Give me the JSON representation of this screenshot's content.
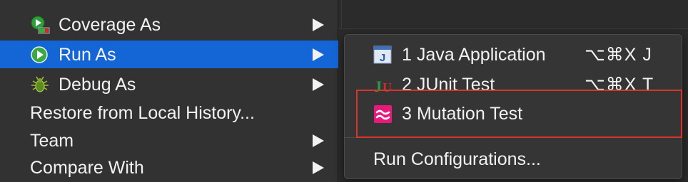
{
  "menu": {
    "items": [
      {
        "label": "Coverage As",
        "icon": "coverage-icon",
        "has_submenu": true
      },
      {
        "label": "Run As",
        "icon": "run-icon",
        "has_submenu": true,
        "selected": true
      },
      {
        "label": "Debug As",
        "icon": "debug-icon",
        "has_submenu": true
      },
      {
        "label": "Restore from Local History...",
        "has_submenu": false
      },
      {
        "label": "Team",
        "has_submenu": true
      },
      {
        "label": "Compare With",
        "has_submenu": true
      }
    ]
  },
  "submenu": {
    "items": [
      {
        "label": "1 Java Application",
        "shortcut": "⌥⌘X J",
        "icon": "java-application-icon"
      },
      {
        "label": "2 JUnit Test",
        "shortcut": "⌥⌘X T",
        "icon": "junit-icon"
      },
      {
        "label": "3 Mutation Test",
        "shortcut": "",
        "icon": "mutation-test-icon",
        "highlighted": true
      },
      {
        "label": "Run Configurations...",
        "shortcut": ""
      }
    ]
  },
  "colors": {
    "menu_bg": "#323232",
    "selection": "#1466d6",
    "submenu_bg": "#353535",
    "highlight_border": "#d9352b",
    "mutation_icon": "#e8197d"
  }
}
